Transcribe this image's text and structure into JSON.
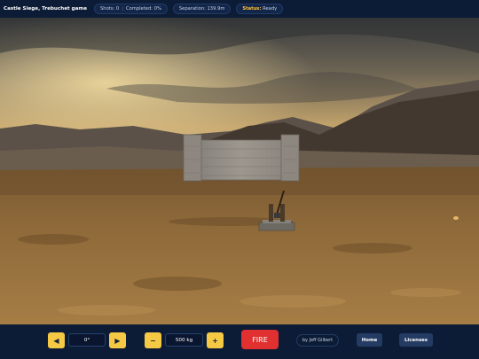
{
  "header": {
    "title": "Castle Siege, Trebuchet game",
    "shots": "Shots: 0",
    "completed": "Completed: 0%",
    "separation": "Separation: 139.9m",
    "status_label": "Status:",
    "status_value": "Ready"
  },
  "controls": {
    "angle_left_icon": "◀",
    "angle_value": "0°",
    "angle_right_icon": "▶",
    "weight_minus_icon": "−",
    "weight_value": "500 kg",
    "weight_plus_icon": "+",
    "fire_label": "FIRE",
    "credit": "by Jeff Gilbert",
    "home_label": "Home",
    "licenses_label": "Licenses"
  },
  "colors": {
    "accent_yellow": "#f6c945",
    "fire_red": "#e03030",
    "bar_background": "#0d1c36"
  }
}
